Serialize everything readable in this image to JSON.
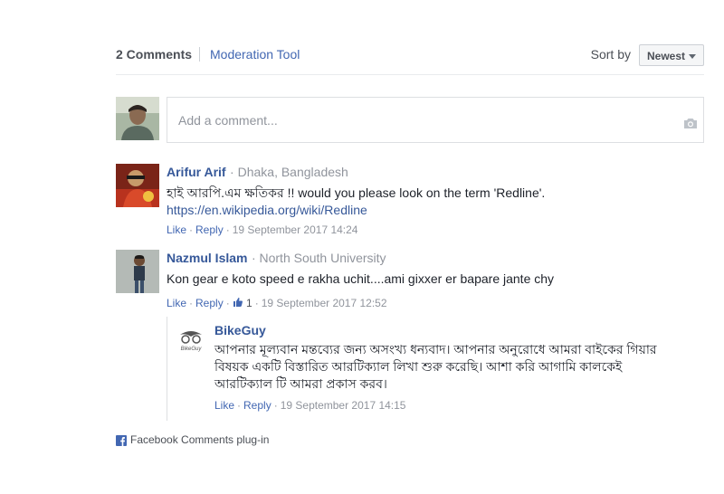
{
  "header": {
    "count_label": "2 Comments",
    "moderation_label": "Moderation Tool",
    "sort_label": "Sort by",
    "sort_value": "Newest"
  },
  "composer": {
    "placeholder": "Add a comment..."
  },
  "comments": [
    {
      "name": "Arifur Arif",
      "meta": "· Dhaka, Bangladesh",
      "text": "হাই আরপি.এম ক্ষতিকর !! would you please look on the term 'Redline'.",
      "link": "https://en.wikipedia.org/wiki/Redline",
      "like": "Like",
      "reply": "Reply",
      "date": "19 September 2017 14:24"
    },
    {
      "name": "Nazmul Islam",
      "meta": "· North South University",
      "text": "Kon gear e koto speed e rakha uchit....ami gixxer er bapare jante chy",
      "like": "Like",
      "reply": "Reply",
      "likes_count": "1",
      "date": "19 September 2017 12:52"
    }
  ],
  "reply": {
    "name": "BikeGuy",
    "text_line1": "আপনার মূল্যবান মন্তব্যের জন্য অসংখ্য ধন্যবাদ। আপনার অনুরোধে আমরা বাইকের গিয়ার",
    "text_line2": "বিষয়ক একটি বিস্তারিত আরটিক্যাল লিখা শুরু করেছি। আশা করি আগামি কালকেই",
    "text_line3": "আরটিক্যাল টি আমরা প্রকাস করব।",
    "like": "Like",
    "reply": "Reply",
    "date": "19 September 2017 14:15",
    "logo_text": "BikeGuy"
  },
  "footer": {
    "label": "Facebook Comments plug-in"
  },
  "colors": {
    "link": "#365899",
    "action": "#4267b2",
    "meta": "#90949c"
  }
}
